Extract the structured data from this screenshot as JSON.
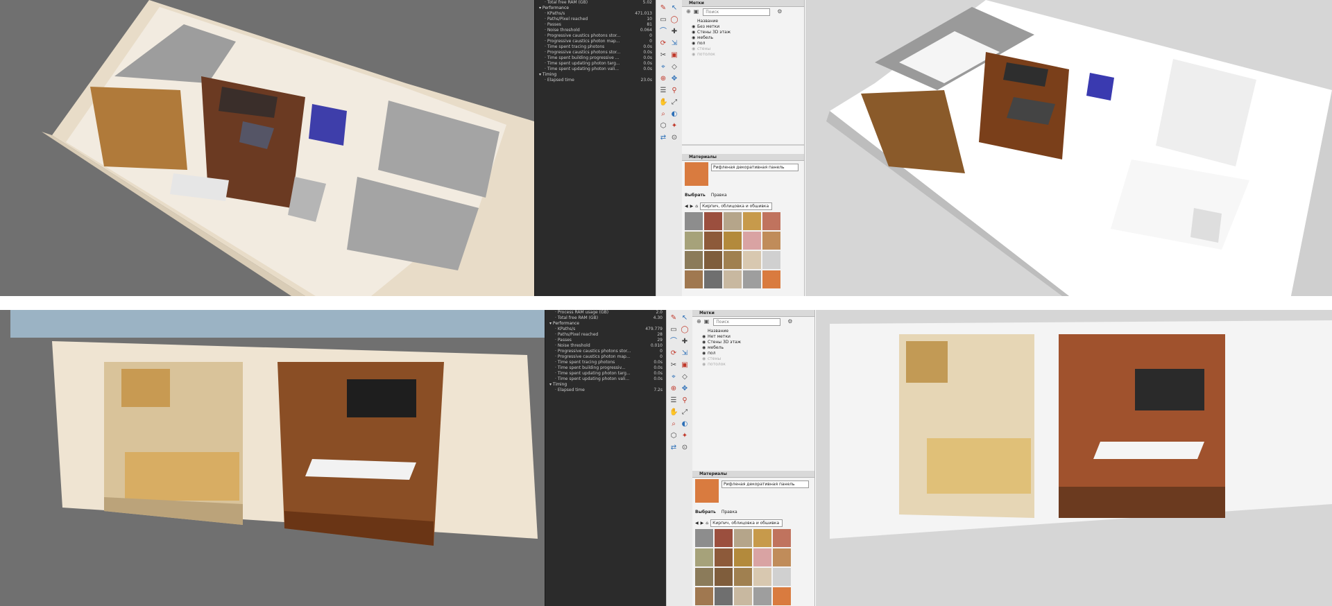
{
  "top": {
    "stats": [
      {
        "label": "Total free RAM (GB)",
        "value": "5.02",
        "level": 1
      },
      {
        "label": "Performance",
        "value": "",
        "level": 0
      },
      {
        "label": "KPaths/s",
        "value": "471.013",
        "level": 1
      },
      {
        "label": "Paths/Pixel reached",
        "value": "10",
        "level": 1
      },
      {
        "label": "Passes",
        "value": "81",
        "level": 1
      },
      {
        "label": "Noise threshold",
        "value": "0.064",
        "level": 1
      },
      {
        "label": "Progressive caustics photons stor...",
        "value": "0",
        "level": 1
      },
      {
        "label": "Progressive caustics photon map...",
        "value": "0",
        "level": 1
      },
      {
        "label": "Time spent tracing photons",
        "value": "0.0s",
        "level": 1
      },
      {
        "label": "Progressive caustics photons stor...",
        "value": "0.0s",
        "level": 1
      },
      {
        "label": "Time spent building progressive ...",
        "value": "0.0s",
        "level": 1
      },
      {
        "label": "Time spent updating photon targ...",
        "value": "0.0s",
        "level": 1
      },
      {
        "label": "Time spent updating photon vali...",
        "value": "0.0s",
        "level": 1
      },
      {
        "label": "Timing",
        "value": "",
        "level": 0
      },
      {
        "label": "Elapsed time",
        "value": "23.0s",
        "level": 1
      }
    ],
    "tags_title": "Метки",
    "search_placeholder": "Поиск",
    "tags_header": "Название",
    "tags": [
      "Без метки",
      "Стены 3D этаж",
      "мебель",
      "пол",
      "стены",
      "потолок"
    ],
    "materials_title": "Материалы",
    "material_name": "Рифленая декоративная панель",
    "tab_select": "Выбрать",
    "tab_edit": "Правка",
    "collection": "Кирпич, облицовка и обшивка"
  },
  "bottom": {
    "stats": [
      {
        "label": "Process RAM usage (GB)",
        "value": "2.0",
        "level": 1
      },
      {
        "label": "Total free RAM (GB)",
        "value": "4.30",
        "level": 1
      },
      {
        "label": "Performance",
        "value": "",
        "level": 0
      },
      {
        "label": "KPaths/s",
        "value": "479.779",
        "level": 1
      },
      {
        "label": "Paths/Pixel reached",
        "value": "28",
        "level": 1
      },
      {
        "label": "Passes",
        "value": "29",
        "level": 1
      },
      {
        "label": "Noise threshold",
        "value": "0.010",
        "level": 1
      },
      {
        "label": "Progressive caustics photons stor...",
        "value": "0",
        "level": 1
      },
      {
        "label": "Progressive caustics photon map...",
        "value": "0",
        "level": 1
      },
      {
        "label": "Time spent tracing photons",
        "value": "0.0s",
        "level": 1
      },
      {
        "label": "Time spent building progressiv...",
        "value": "0.0s",
        "level": 1
      },
      {
        "label": "Time spent updating photon targ...",
        "value": "0.0s",
        "level": 1
      },
      {
        "label": "Time spent updating photon vali...",
        "value": "0.0s",
        "level": 1
      },
      {
        "label": "Timing",
        "value": "",
        "level": 0
      },
      {
        "label": "Elapsed time",
        "value": "7.2s",
        "level": 1
      }
    ],
    "tags_title": "Метки",
    "search_placeholder": "Поиск",
    "tags_header": "Название",
    "tags": [
      "Нет метки",
      "Стены 3D этаж",
      "мебель",
      "пол",
      "стены",
      "потолок"
    ],
    "materials_title": "Материалы",
    "material_name": "Рифленая декоративная панель",
    "tab_select": "Выбрать",
    "tab_edit": "Правка",
    "collection": "Кирпич, облицовка и обшивка"
  },
  "colors": {
    "render_bg": "#707070",
    "sketch_bg": "#d6d6d6",
    "wood": "#a0522d",
    "accent_tool": "#c0392b"
  },
  "swatch_colors": [
    "#8d8d8d",
    "#9b4f3e",
    "#b5a58a",
    "#c79a4b",
    "#c0735e",
    "#a6a27a",
    "#8d5a3a",
    "#b38a3c",
    "#d9a3a3",
    "#c08c5a",
    "#8b7b5a",
    "#7f5d3c",
    "#a08050",
    "#d8c8b0",
    "#d0d0d0",
    "#a07850",
    "#6f6f6f",
    "#c8b8a0",
    "#9e9e9e",
    "#d97b3f"
  ]
}
